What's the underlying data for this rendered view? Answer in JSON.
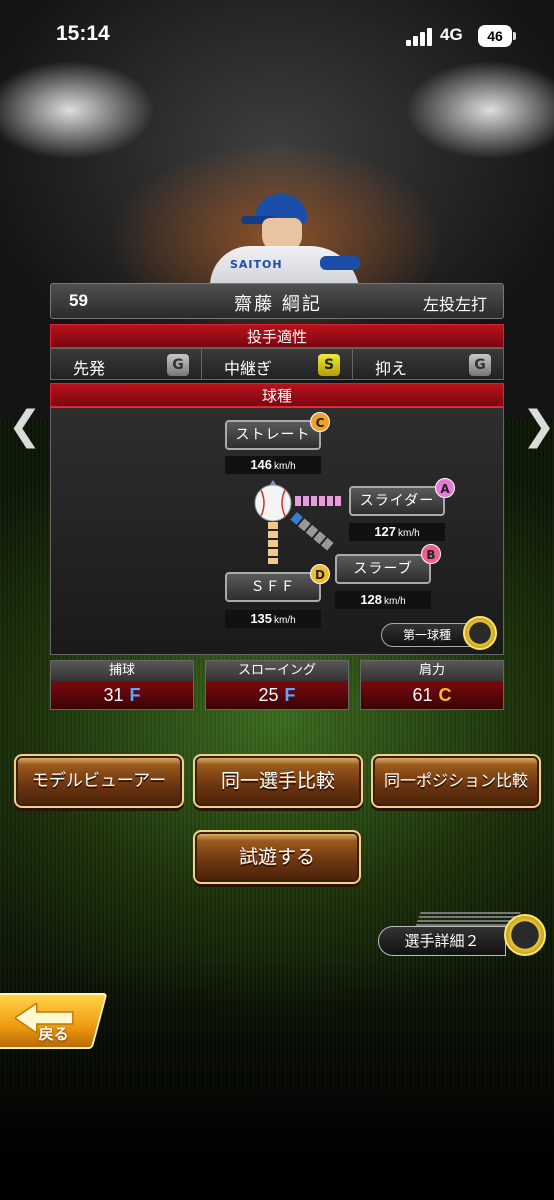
{
  "status_bar": {
    "time": "15:14",
    "network": "4G",
    "battery": "46"
  },
  "player": {
    "number": "59",
    "name": "齋藤 綱記",
    "handedness": "左投左打",
    "jersey_text": "SAITOH"
  },
  "aptitude": {
    "title": "投手適性",
    "roles": [
      {
        "label": "先発",
        "grade": "G"
      },
      {
        "label": "中継ぎ",
        "grade": "S"
      },
      {
        "label": "抑え",
        "grade": "G"
      }
    ]
  },
  "pitches": {
    "title": "球種",
    "list": [
      {
        "name": "ストレート",
        "speed": "146",
        "unit": "km/h",
        "grade": "C"
      },
      {
        "name": "スライダー",
        "speed": "127",
        "unit": "km/h",
        "grade": "A"
      },
      {
        "name": "スラーブ",
        "speed": "128",
        "unit": "km/h",
        "grade": "B"
      },
      {
        "name": "ＳＦＦ",
        "speed": "135",
        "unit": "km/h",
        "grade": "D"
      }
    ],
    "first_pitch_label": "第一球種"
  },
  "fielding": [
    {
      "label": "捕球",
      "value": "31",
      "rank": "F"
    },
    {
      "label": "スローイング",
      "value": "25",
      "rank": "F"
    },
    {
      "label": "肩力",
      "value": "61",
      "rank": "C"
    }
  ],
  "actions": {
    "model_viewer": "モデルビューアー",
    "same_player_compare": "同一選手比較",
    "same_position_compare": "同一ポジション比較",
    "trial_play": "試遊する"
  },
  "detail_button": "選手詳細２",
  "back_button": "戻る",
  "nav": {
    "prev": "❮",
    "next": "❯"
  },
  "colors": {
    "header_red": "#b8121b",
    "grade_s": "#f2ea3a",
    "rank_f": "#5aa8ff",
    "rank_c": "#f2be28",
    "button_gold": "#f0d08c"
  }
}
